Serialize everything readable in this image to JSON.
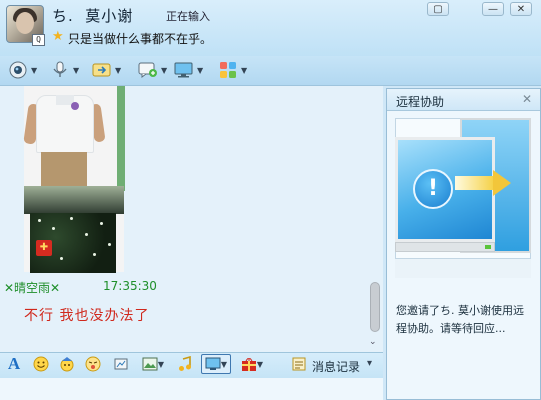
{
  "header": {
    "contact_name": "ち.  莫小谢",
    "typing_status": "正在输入",
    "signature": "只是当做什么事都不在乎。",
    "avatar_badge": "Q",
    "window_controls": {
      "menu": "▢",
      "minimize": "—",
      "close": "✕"
    }
  },
  "toolbar": {
    "icons": [
      "video-icon",
      "voice-icon",
      "file-transfer-icon",
      "sms-icon",
      "remote-desktop-icon",
      "apps-icon"
    ]
  },
  "chat": {
    "sender": "✕晴空雨✕",
    "time": "17:35:30",
    "message": "不行 我也没办法了"
  },
  "input_toolbar": {
    "font_icon": "A",
    "history_label": "消息记录",
    "dropdown": "▾"
  },
  "remote_panel": {
    "title": "远程协助",
    "close": "✕",
    "warning_glyph": "!",
    "message": "您邀请了ち.  莫小谢使用远程协助。请等待回应..."
  },
  "colors": {
    "header_bg": "#cfe7f7",
    "chat_bg": "#e4f1fa",
    "sender_color": "#1f8f2a",
    "message_color": "#d0281c"
  }
}
